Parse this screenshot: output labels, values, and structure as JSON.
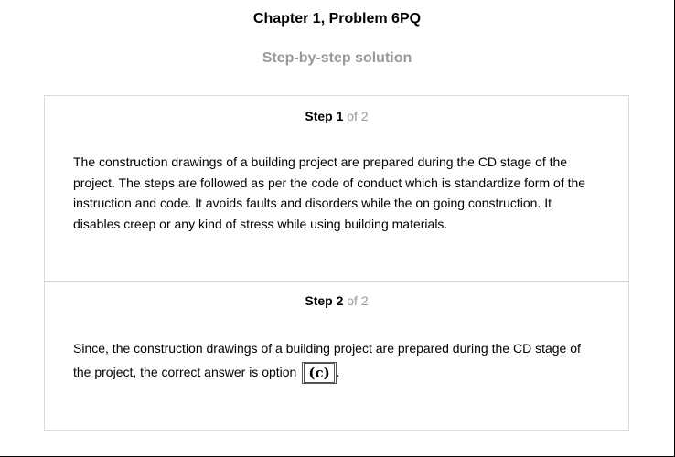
{
  "header": {
    "title": "Chapter 1, Problem 6PQ",
    "subtitle": "Step-by-step solution"
  },
  "steps": [
    {
      "label": "Step 1",
      "of": "of 2",
      "text": "The construction drawings of a building project are prepared during the CD stage of the project. The steps are followed as per the code of conduct which is standardize form of the instruction and code. It avoids faults and disorders while the on going construction. It disables creep or any kind of stress while using building materials."
    },
    {
      "label": "Step 2",
      "of": "of 2",
      "text": "Since, the construction drawings of a building project are prepared during the CD stage of the project, the correct answer is option",
      "answer": "(c)",
      "suffix": "."
    }
  ]
}
